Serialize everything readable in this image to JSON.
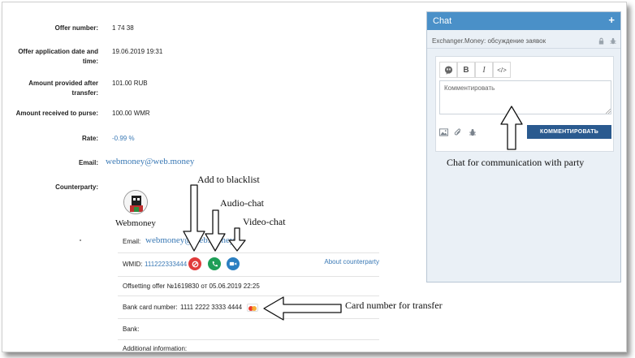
{
  "offer": {
    "number_label": "Offer number:",
    "number_value": "1  74  38",
    "date_label_1": "Offer application date and",
    "date_label_2": "time:",
    "date_value": "19.06.2019 19:31",
    "provided_label_1": "Amount provided after",
    "provided_label_2": "transfer:",
    "provided_value": "101.00 RUB",
    "received_label": "Amount received to purse:",
    "received_value": "100.00 WMR",
    "rate_label": "Rate:",
    "rate_value": "-0.99 %",
    "email_label": "Email:",
    "email_value": "webmoney@web.money",
    "counterparty_label": "Counterparty:"
  },
  "counterparty": {
    "name": "Webmoney",
    "email_label": "Email:",
    "email_value": "webmoney@web.money",
    "wmid_label": "WMID:",
    "wmid_value": "111222333444",
    "about_link": "About counterparty",
    "offsetting": "Offsetting offer №1619830 от 05.06.2019 22:25",
    "bank_card_label": "Bank card number:",
    "bank_card_value": "1111 2222 3333 4444",
    "bank_label": "Bank:",
    "additional_label": "Additional information:"
  },
  "chat": {
    "title": "Chat",
    "plus": "+",
    "subtitle": "Exchanger.Money: обсуждение заявок",
    "toolbar_bold": "B",
    "toolbar_italic": "I",
    "toolbar_code": "</>",
    "comment_placeholder": "Комментировать",
    "comment_button": "КОММЕНТИРОВАТЬ"
  },
  "annotations": {
    "blacklist": "Add to blacklist",
    "audio": "Audio-chat",
    "video": "Video-chat",
    "card": "Card number for transfer",
    "chat": "Chat for communication with party"
  },
  "colors": {
    "accent_blue": "#4a90c8",
    "link_blue": "#3a79b5",
    "button_dark": "#2a5a8f",
    "blacklist_red": "#e03b3b",
    "audio_green": "#1e9e57",
    "video_blue": "#2b7fc1"
  }
}
